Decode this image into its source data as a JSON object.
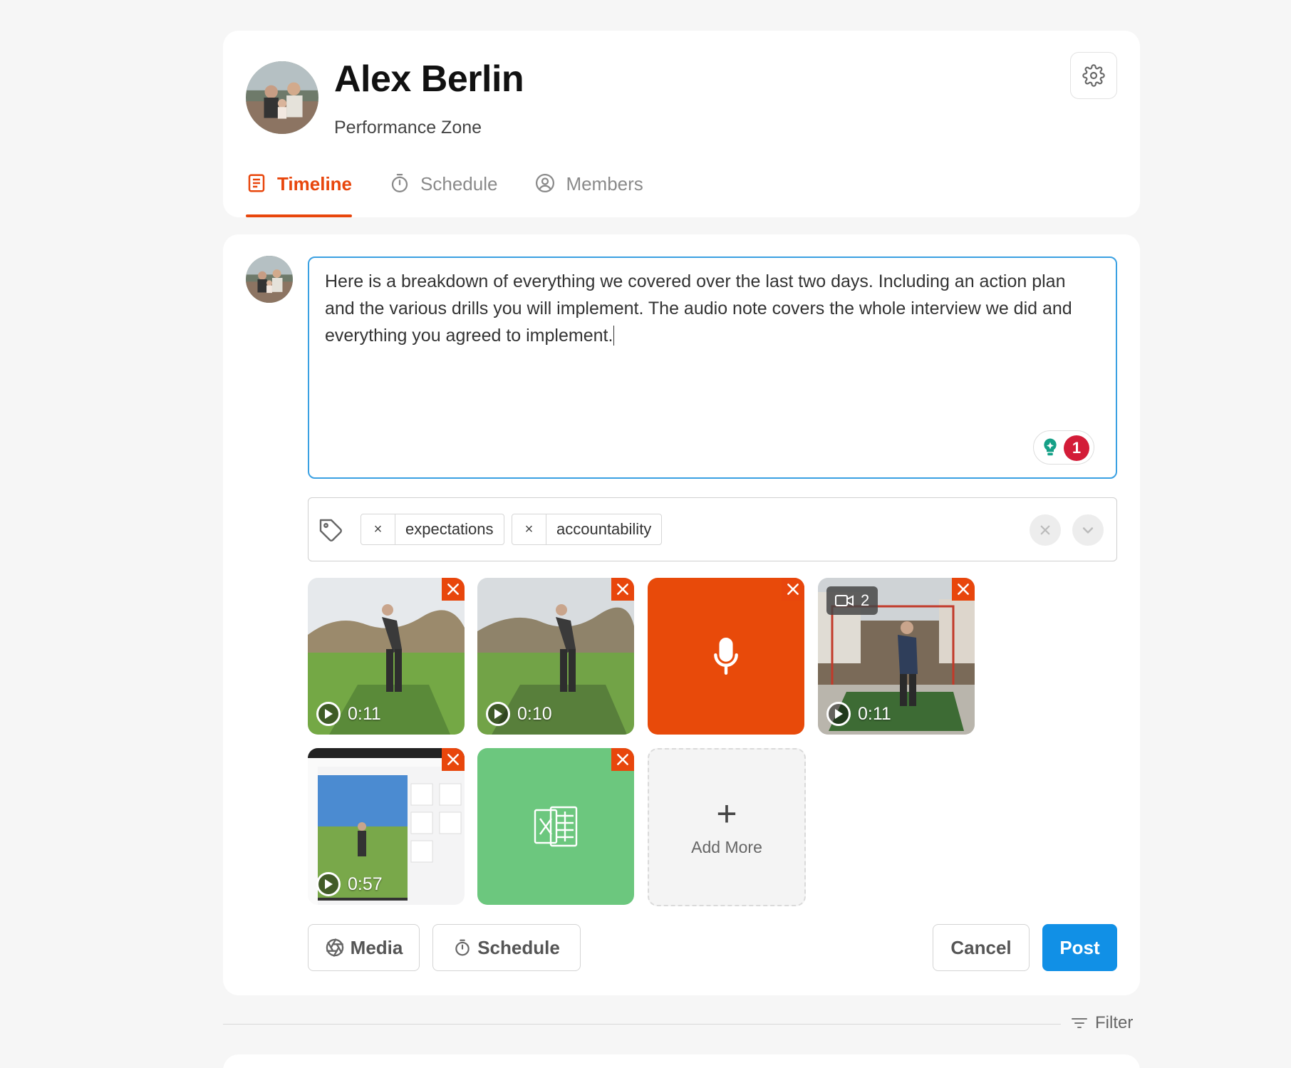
{
  "profile": {
    "name": "Alex Berlin",
    "subtitle": "Performance Zone"
  },
  "tabs": [
    {
      "label": "Timeline",
      "icon": "timeline-icon",
      "active": true
    },
    {
      "label": "Schedule",
      "icon": "stopwatch-icon",
      "active": false
    },
    {
      "label": "Members",
      "icon": "user-circle-icon",
      "active": false
    }
  ],
  "composer": {
    "text": "Here is a breakdown of everything we covered over the last two days. Including an  action plan and the various drills you will implement. The audio note covers the whole interview we did and everything you agreed to implement.",
    "grammar_count": "1",
    "tags": [
      {
        "label": "expectations",
        "remove": "×"
      },
      {
        "label": "accountability",
        "remove": "×"
      }
    ],
    "attachments": [
      {
        "type": "video",
        "duration": "0:11"
      },
      {
        "type": "video",
        "duration": "0:10"
      },
      {
        "type": "audio",
        "icon": "microphone-icon"
      },
      {
        "type": "video",
        "duration": "0:11",
        "count": "2"
      },
      {
        "type": "video",
        "duration": "0:57"
      },
      {
        "type": "spreadsheet",
        "icon": "excel-icon"
      }
    ],
    "add_more": "Add More",
    "buttons": {
      "media": "Media",
      "schedule": "Schedule",
      "cancel": "Cancel",
      "post": "Post"
    }
  },
  "filter": {
    "label": "Filter"
  },
  "colors": {
    "accent": "#e8460c",
    "primary": "#1190e6",
    "audio_tile": "#e84a0a",
    "sheet_tile": "#6cc77e",
    "input_border": "#3aa0e2"
  }
}
